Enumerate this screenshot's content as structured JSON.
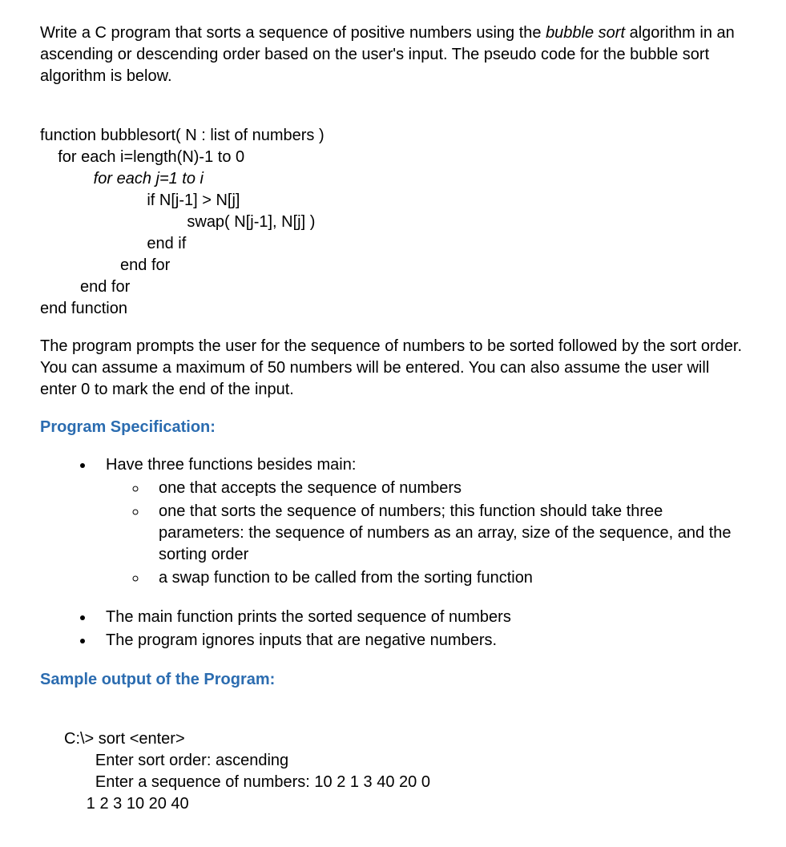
{
  "intro": {
    "part1": "Write a C program that sorts a sequence of positive numbers using the ",
    "italic": "bubble sort",
    "part2": " algorithm in an ascending or descending order based on the user's input.  The pseudo code for the bubble sort algorithm is below."
  },
  "pseudo": {
    "l1": "function bubblesort( N : list of numbers )",
    "l2": "    for each i=length(N)-1 to 0",
    "l3_italic": "            for each j=1 to i",
    "l4": "                        if N[j-1] > N[j]",
    "l5": "                                 swap( N[j-1], N[j] )",
    "l6": "                        end if",
    "l7": "                  end for",
    "l8": "         end for",
    "l9": "end function"
  },
  "afterPseudo": "The program prompts the user for the sequence of numbers to be sorted followed by the sort order. You can assume a maximum of 50 numbers will be entered. You can also assume the user will enter 0 to mark the end of the input.",
  "specHeading": "Program Specification:",
  "spec": {
    "item1": "Have three functions besides main:",
    "sub1": "one that accepts the sequence of numbers",
    "sub2": "one that sorts the sequence of numbers; this function should take three parameters: the sequence of numbers as an array, size of the sequence, and the sorting order",
    "sub3": "a swap function to be called from the sorting function",
    "item2": "The main function prints the sorted sequence of numbers",
    "item3": "The program ignores inputs that are negative numbers."
  },
  "sampleHeading": "Sample output of the Program:",
  "sample": {
    "l1": "C:\\> sort <enter>",
    "l2": "       Enter sort order: ascending",
    "l3": "       Enter a sequence of numbers: 10 2 1 3 40 20 0",
    "l4": "     1 2 3 10 20 40"
  }
}
